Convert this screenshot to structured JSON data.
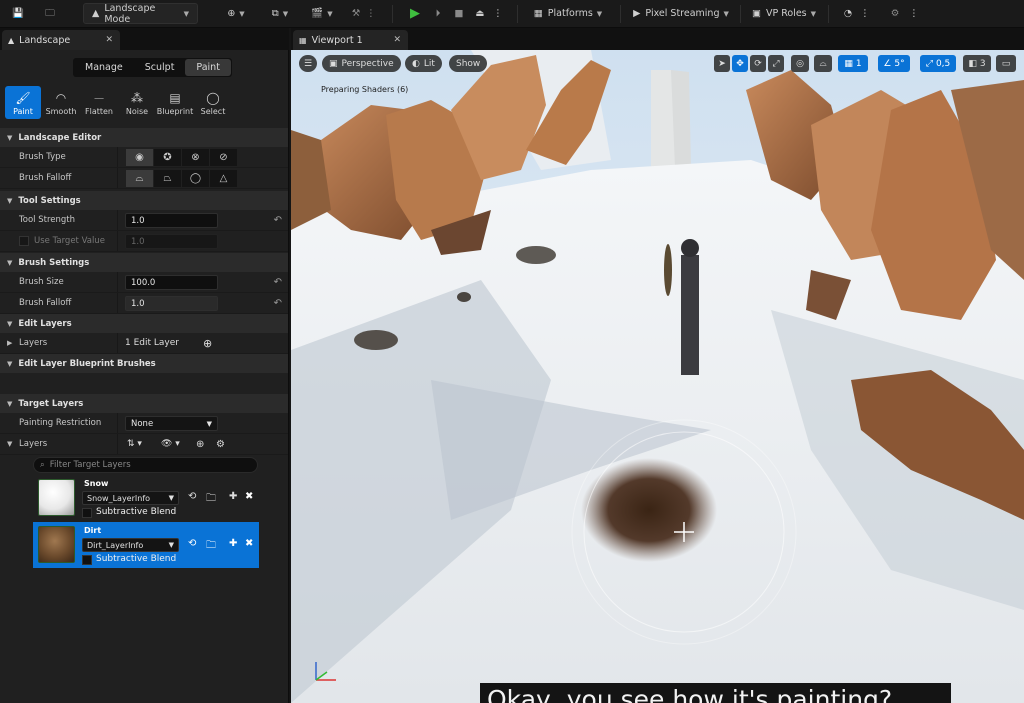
{
  "toolbar": {
    "mode_label": "Landscape Mode",
    "platforms_label": "Platforms",
    "pixel_streaming_label": "Pixel Streaming",
    "vp_roles_label": "VP Roles"
  },
  "left_tab": {
    "title": "Landscape"
  },
  "viewport_tab": {
    "title": "Viewport 1"
  },
  "mode_tabs": [
    "Manage",
    "Sculpt",
    "Paint"
  ],
  "tools": [
    "Paint",
    "Smooth",
    "Flatten",
    "Noise",
    "Blueprint",
    "Select"
  ],
  "sections": {
    "landscape_editor": "Landscape Editor",
    "tool_settings": "Tool Settings",
    "brush_settings": "Brush Settings",
    "edit_layers": "Edit Layers",
    "blueprint_brushes": "Edit Layer Blueprint Brushes",
    "target_layers": "Target Layers"
  },
  "props": {
    "brush_type": "Brush Type",
    "brush_falloff": "Brush Falloff",
    "tool_strength": "Tool Strength",
    "tool_strength_value": "1.0",
    "use_target_value": "Use Target Value",
    "use_target_value_value": "1.0",
    "brush_size": "Brush Size",
    "brush_size_value": "100.0",
    "brush_falloff2": "Brush Falloff",
    "brush_falloff2_value": "1.0",
    "layers": "Layers",
    "edit_layer_count": "1 Edit Layer",
    "painting_restriction": "Painting Restriction",
    "painting_restriction_value": "None",
    "target_layers_label": "Layers"
  },
  "search": {
    "placeholder": "Filter Target Layers"
  },
  "target_layers": [
    {
      "name": "Snow",
      "info": "Snow_LayerInfo",
      "blend": "Subtractive Blend"
    },
    {
      "name": "Dirt",
      "info": "Dirt_LayerInfo",
      "blend": "Subtractive Blend"
    }
  ],
  "viewport": {
    "perspective": "Perspective",
    "lit": "Lit",
    "show": "Show",
    "grid_value": "1",
    "angle_value": "5°",
    "scale_value": "0,5",
    "camera_speed": "3",
    "status": "Preparing Shaders (6)",
    "caption": "Okay, you see how it's painting?"
  }
}
